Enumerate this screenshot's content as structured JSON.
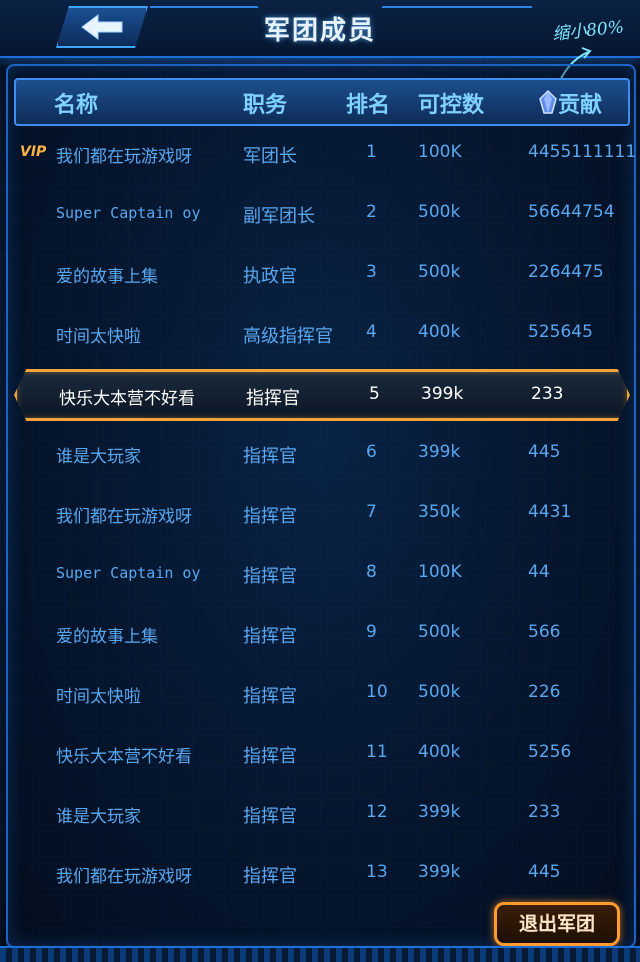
{
  "header": {
    "title": "军团成员",
    "annotation": "缩小80%"
  },
  "columns": {
    "name": "名称",
    "role": "职务",
    "rank": "排名",
    "power": "可控数",
    "contribution": "贡献"
  },
  "vip_badge": "VIP",
  "members": [
    {
      "name": "我们都在玩游戏呀",
      "role": "军团长",
      "rank": "1",
      "power": "100K",
      "contribution": "4455111111"
    },
    {
      "name": "Super Captain oy",
      "role": "副军团长",
      "rank": "2",
      "power": "500k",
      "contribution": "56644754"
    },
    {
      "name": "爱的故事上集",
      "role": "执政官",
      "rank": "3",
      "power": "500k",
      "contribution": "2264475"
    },
    {
      "name": "时间太快啦",
      "role": "高级指挥官",
      "rank": "4",
      "power": "400k",
      "contribution": "525645"
    },
    {
      "name": "快乐大本营不好看",
      "role": "指挥官",
      "rank": "5",
      "power": "399k",
      "contribution": "233"
    },
    {
      "name": "谁是大玩家",
      "role": "指挥官",
      "rank": "6",
      "power": "399k",
      "contribution": "445"
    },
    {
      "name": "我们都在玩游戏呀",
      "role": "指挥官",
      "rank": "7",
      "power": "350k",
      "contribution": "4431"
    },
    {
      "name": "Super Captain oy",
      "role": "指挥官",
      "rank": "8",
      "power": "100K",
      "contribution": "44"
    },
    {
      "name": "爱的故事上集",
      "role": "指挥官",
      "rank": "9",
      "power": "500k",
      "contribution": "566"
    },
    {
      "name": "时间太快啦",
      "role": "指挥官",
      "rank": "10",
      "power": "500k",
      "contribution": "226"
    },
    {
      "name": "快乐大本营不好看",
      "role": "指挥官",
      "rank": "11",
      "power": "400k",
      "contribution": "5256"
    },
    {
      "name": "谁是大玩家",
      "role": "指挥官",
      "rank": "12",
      "power": "399k",
      "contribution": "233"
    },
    {
      "name": "我们都在玩游戏呀",
      "role": "指挥官",
      "rank": "13",
      "power": "399k",
      "contribution": "445"
    }
  ],
  "footer": {
    "exit_label": "退出军团"
  },
  "icons": {
    "back": "back-arrow-icon",
    "contribution": "crystal-gem-icon"
  },
  "colors": {
    "accent": "#3da4ff",
    "highlight": "#f2a33a",
    "text": "#5aa7f0"
  }
}
